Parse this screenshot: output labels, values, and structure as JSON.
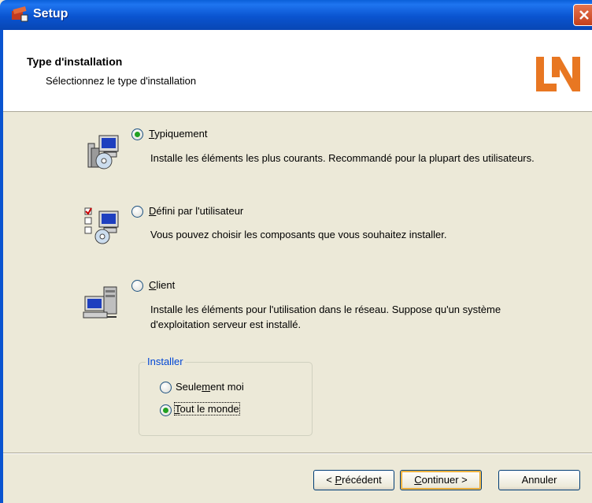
{
  "window": {
    "title": "Setup"
  },
  "header": {
    "title": "Type d'installation",
    "subtitle": "Sélectionnez le type d'installation",
    "logo_text": "LN",
    "logo_color": "#e87722"
  },
  "options": [
    {
      "label": "Typiquement",
      "mnemonic": "T",
      "rest": "ypiquement",
      "description": "Installe les éléments les plus courants. Recommandé pour la plupart des utilisateurs.",
      "selected": true,
      "icon": "typical-setup-icon"
    },
    {
      "label": "Défini par l'utilisateur",
      "mnemonic": "D",
      "rest": "éfini par l'utilisateur",
      "description": "Vous pouvez choisir les composants que vous souhaitez installer.",
      "selected": false,
      "icon": "custom-setup-icon"
    },
    {
      "label": "Client",
      "mnemonic": "C",
      "rest": "lient",
      "description": "Installe les éléments pour l'utilisation dans le réseau. Suppose qu'un système d'exploitation serveur est installé.",
      "selected": false,
      "icon": "client-network-icon"
    }
  ],
  "install_for": {
    "legend": "Installer",
    "choices": [
      {
        "label": "Seulement moi",
        "pre": "Seule",
        "mnemonic": "m",
        "post": "ent moi",
        "selected": false
      },
      {
        "label": "Tout le monde",
        "pre": "",
        "mnemonic": "T",
        "post": "out le monde",
        "selected": true
      }
    ]
  },
  "buttons": {
    "back": {
      "pre": "< ",
      "mnemonic": "P",
      "post": "récédent"
    },
    "next": {
      "pre": "",
      "mnemonic": "C",
      "post": "ontinuer >"
    },
    "cancel": {
      "label": "Annuler"
    }
  },
  "colors": {
    "titlebar": "#0a54d0",
    "accent_green": "#21a121",
    "window_bg": "#ece9d8"
  }
}
